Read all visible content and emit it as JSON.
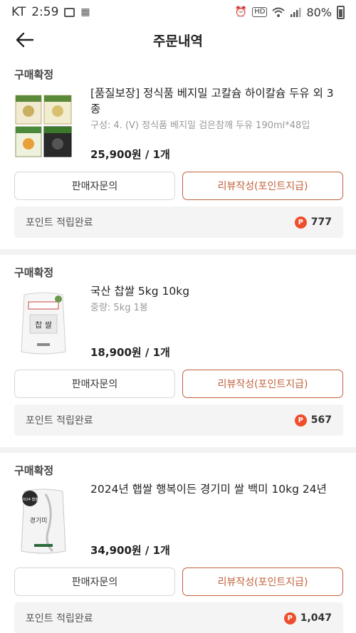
{
  "statusbar": {
    "carrier": "KT",
    "time": "2:59",
    "battery": "80%",
    "hd": "HD"
  },
  "header": {
    "title": "주문내역"
  },
  "orders": [
    {
      "status": "구매확정",
      "product_name": "[품질보장] 정식품 베지밀 고칼슘 하이칼슘 두유 외 3종",
      "option": "구성: 4. (V) 정식품 베지밀 검은참깨 두유 190ml*48입",
      "price_qty": "25,900원 / 1개",
      "inquiry_label": "판매자문의",
      "review_label": "리뷰작성(포인트지급)",
      "points_label": "포인트 적립완료",
      "points_value": "777",
      "points_badge": "P"
    },
    {
      "status": "구매확정",
      "product_name": "국산 찹쌀 5kg 10kg",
      "option": "중량: 5kg 1봉",
      "price_qty": "18,900원 / 1개",
      "inquiry_label": "판매자문의",
      "review_label": "리뷰작성(포인트지급)",
      "points_label": "포인트 적립완료",
      "points_value": "567",
      "points_badge": "P"
    },
    {
      "status": "구매확정",
      "product_name": "2024년 햅쌀 행복이든 경기미 쌀 백미 10kg 24년",
      "option": "",
      "price_qty": "34,900원 / 1개",
      "inquiry_label": "판매자문의",
      "review_label": "리뷰작성(포인트지급)",
      "points_label": "포인트 적립완료",
      "points_value": "1,047",
      "points_badge": "P"
    }
  ],
  "product_image_text": {
    "rice_bag_label": "찹 쌀",
    "rice_bag2_badge": "2024 햅쌀",
    "rice_bag2_label": "경기미"
  },
  "colors": {
    "accent": "#c0603a",
    "points_badge": "#ee4e2c"
  }
}
